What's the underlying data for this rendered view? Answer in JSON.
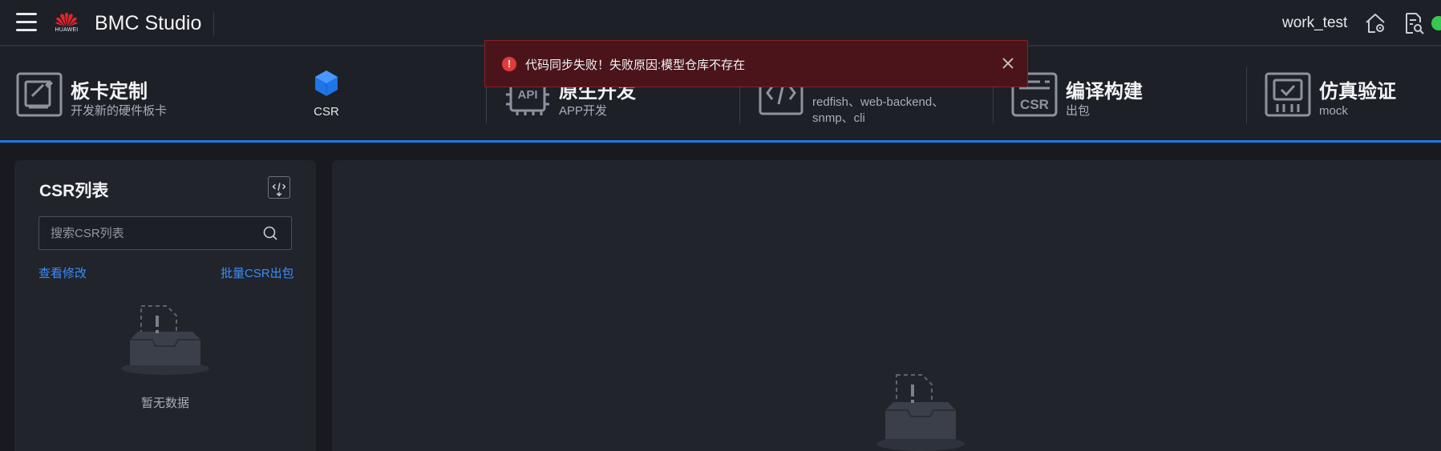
{
  "header": {
    "logo_text": "HUAWEI",
    "app_title": "BMC Studio",
    "project_name": "work_test",
    "status_color": "#37c94f",
    "icons": [
      "menu-icon",
      "home-settings-icon",
      "document-search-icon"
    ]
  },
  "stages": [
    {
      "name": "板卡定制",
      "desc": "开发新的硬件板卡",
      "icon": "board-icon"
    },
    {
      "name": "原生开发",
      "desc": "APP开发",
      "icon": "api-chip-icon"
    },
    {
      "name": "",
      "desc_lines": [
        "redfish、web-backend、",
        "snmp、cli"
      ],
      "icon": "interface-code-icon"
    },
    {
      "name": "编译构建",
      "desc": "出包",
      "icon": "csr-build-icon"
    },
    {
      "name": "仿真验证",
      "desc": "mock",
      "icon": "simulation-monitor-icon"
    }
  ],
  "csr_subtab": {
    "label": "CSR",
    "accent": "#1f74e6"
  },
  "toast": {
    "message": "代码同步失败！失败原因:模型仓库不存在",
    "type": "error",
    "color": "#e23a3a"
  },
  "csr_panel": {
    "title": "CSR列表",
    "search_placeholder": "搜索CSR列表",
    "view_changes_link": "查看修改",
    "batch_package_link": "批量CSR出包",
    "empty_text": "暂无数据"
  },
  "colors": {
    "accent": "#1f74e6",
    "link": "#3b8cff",
    "background": "#181a1f",
    "panel": "#21242b"
  }
}
